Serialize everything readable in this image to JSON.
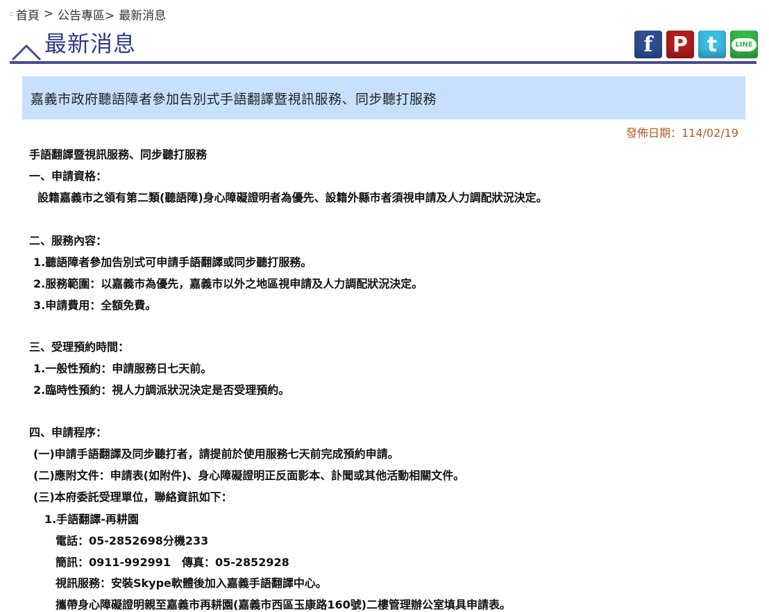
{
  "breadcrumb": {
    "home": "首頁",
    "separator": ">",
    "section": "公告專區>",
    "current": "最新消息"
  },
  "page": {
    "title": "最新消息"
  },
  "share": {
    "facebook": "f",
    "plurk": "P",
    "twitter": "t",
    "line": "LINE"
  },
  "news": {
    "headline": "嘉義市政府聽語障者參加告別式手語翻譯暨視訊服務、同步聽打服務",
    "publish_date": "發佈日期：114/02/19"
  },
  "body": {
    "lines": [
      "手語翻譯暨視訊服務、同步聽打服務",
      "一、申請資格：",
      "設籍嘉義市之領有第二類(聽語障)身心障礙證明者為優先、設籍外縣市者須視申請及人力調配狀況決定。",
      "二、服務內容：",
      "1.聽語障者參加告別式可申請手語翻譯或同步聽打服務。",
      "2.服務範圍：以嘉義市為優先，嘉義市以外之地區視申請及人力調配狀況決定。",
      "3.申請費用：全額免費。",
      "三、受理預約時間：",
      "1.一般性預約：申請服務日七天前。",
      "2.臨時性預約：視人力調派狀況決定是否受理預約。",
      "四、申請程序：",
      "(一)申請手語翻譯及同步聽打者，請提前於使用服務七天前完成預約申請。",
      "(二)應附文件：申請表(如附件)、身心障礙證明正反面影本、訃聞或其他活動相關文件。",
      "(三)本府委託受理單位，聯絡資訊如下：",
      "1.手語翻譯-再耕園",
      "電話：05-2852698分機233",
      "簡訊：0911-992991　傳真：05-2852928",
      "視訊服務：安裝Skype軟體後加入嘉義手語翻譯中心。",
      "攜帶身心障礙證明親至嘉義市再耕園(嘉義市西區玉康路160號)二樓管理辦公室填具申請表。"
    ]
  }
}
